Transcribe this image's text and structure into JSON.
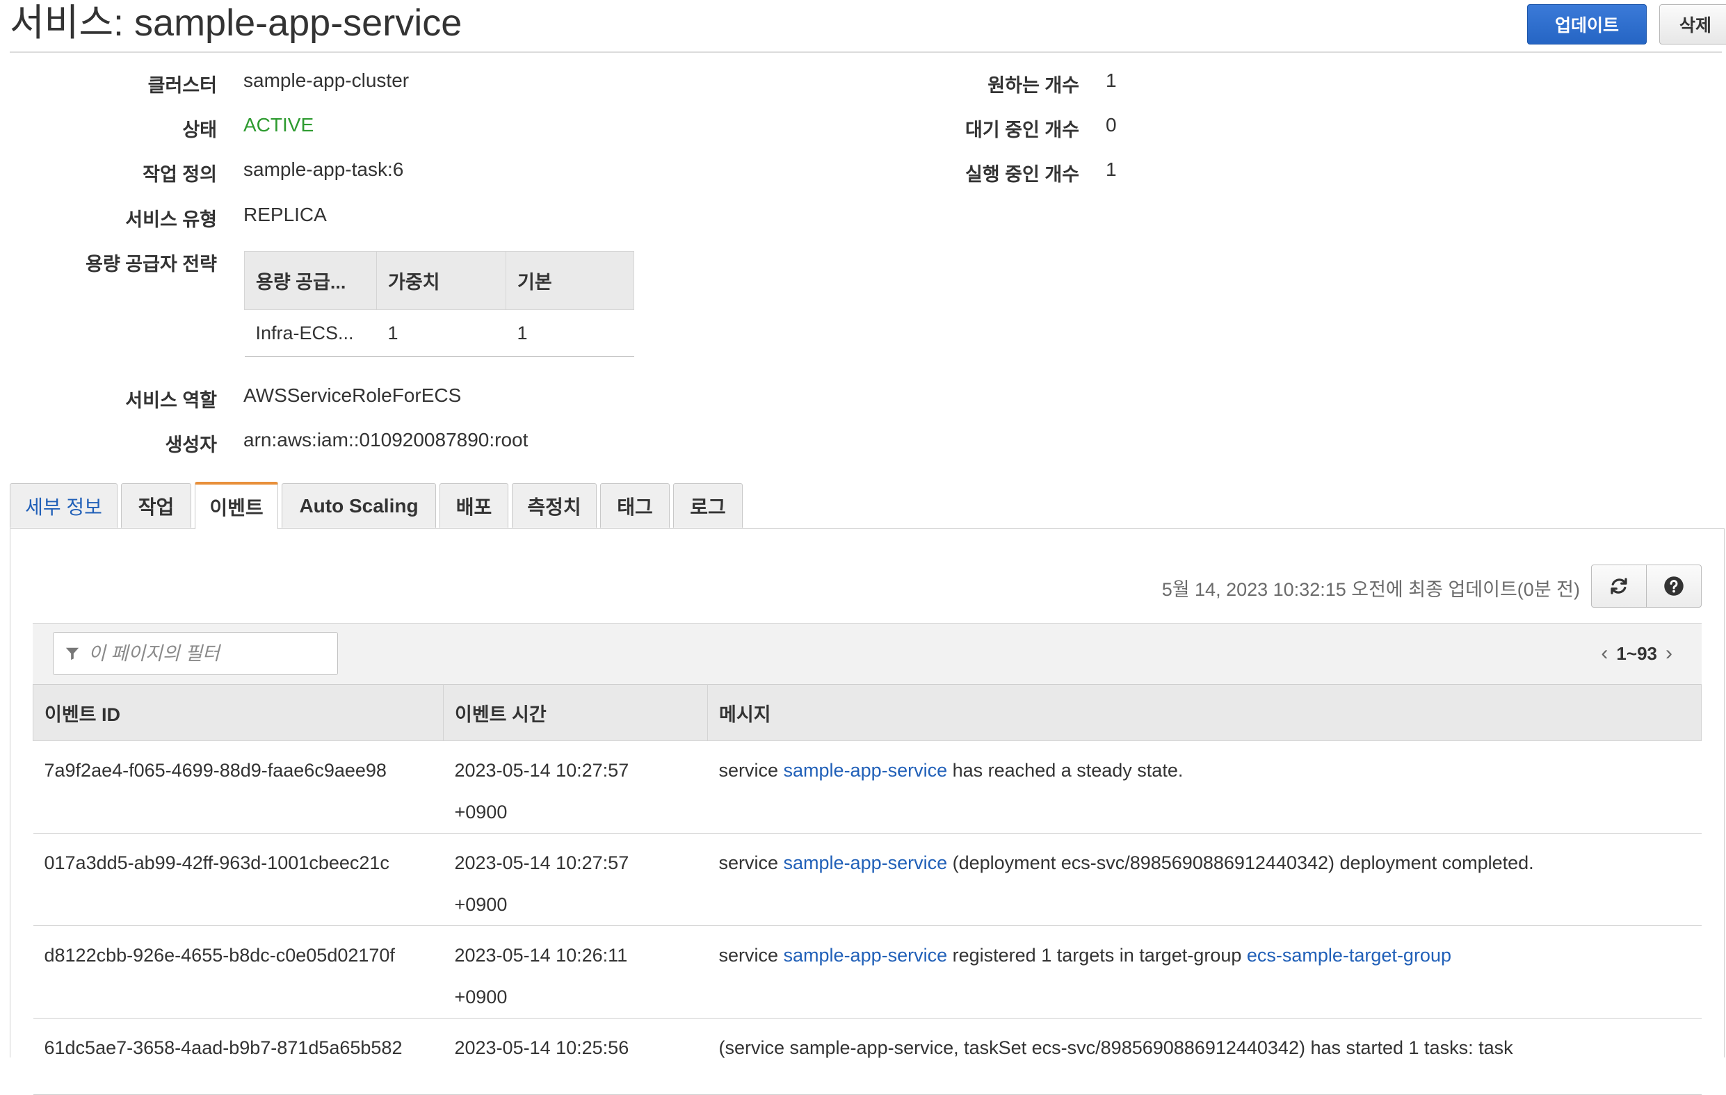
{
  "header": {
    "title": "서비스: sample-app-service",
    "update_button": "업데이트",
    "delete_button": "삭제"
  },
  "details": {
    "cluster_label": "클러스터",
    "cluster_value": "sample-app-cluster",
    "status_label": "상태",
    "status_value": "ACTIVE",
    "task_def_label": "작업 정의",
    "task_def_value": "sample-app-task:6",
    "service_type_label": "서비스 유형",
    "service_type_value": "REPLICA",
    "capacity_strategy_label": "용량 공급자 전략",
    "service_role_label": "서비스 역할",
    "service_role_value": "AWSServiceRoleForECS",
    "created_by_label": "생성자",
    "created_by_value": "arn:aws:iam::010920087890:root",
    "desired_label": "원하는 개수",
    "desired_value": "1",
    "pending_label": "대기 중인 개수",
    "pending_value": "0",
    "running_label": "실행 중인 개수",
    "running_value": "1"
  },
  "capacity_table": {
    "headers": [
      "용량 공급...",
      "가중치",
      "기본"
    ],
    "rows": [
      [
        "Infra-ECS...",
        "1",
        "1"
      ]
    ]
  },
  "tabs": [
    {
      "label": "세부 정보"
    },
    {
      "label": "작업"
    },
    {
      "label": "이벤트"
    },
    {
      "label": "Auto Scaling"
    },
    {
      "label": "배포"
    },
    {
      "label": "측정치"
    },
    {
      "label": "태그"
    },
    {
      "label": "로그"
    }
  ],
  "active_tab": "이벤트",
  "events_panel": {
    "last_updated": "5월 14, 2023 10:32:15 오전에 최종 업데이트(0분 전)",
    "refresh_icon": "refresh-icon",
    "help_icon": "question-circle-icon",
    "filter_placeholder": "이 페이지의 필터",
    "filter_icon": "funnel-icon",
    "pagination": "1~93"
  },
  "events_table": {
    "headers": [
      "이벤트 ID",
      "이벤트 시간",
      "메시지"
    ],
    "rows": [
      {
        "id": "7a9f2ae4-f065-4699-88d9-faae6c9aee98",
        "time_date": "2023-05-14 10:27:57",
        "time_tz": "+0900",
        "msg_pre": "service ",
        "msg_link": "sample-app-service",
        "msg_post": " has reached a steady state.",
        "msg_link2": "",
        "msg_tail": ""
      },
      {
        "id": "017a3dd5-ab99-42ff-963d-1001cbeec21c",
        "time_date": "2023-05-14 10:27:57",
        "time_tz": "+0900",
        "msg_pre": "service ",
        "msg_link": "sample-app-service",
        "msg_post": " (deployment ecs-svc/8985690886912440342) deployment completed.",
        "msg_link2": "",
        "msg_tail": ""
      },
      {
        "id": "d8122cbb-926e-4655-b8dc-c0e05d02170f",
        "time_date": "2023-05-14 10:26:11",
        "time_tz": "+0900",
        "msg_pre": "service ",
        "msg_link": "sample-app-service",
        "msg_post": " registered 1 targets in target-group ",
        "msg_link2": "ecs-sample-target-group",
        "msg_tail": ""
      },
      {
        "id": "61dc5ae7-3658-4aad-b9b7-871d5a65b582",
        "time_date": "2023-05-14 10:25:56",
        "time_tz": "",
        "msg_pre": "(service sample-app-service, taskSet ecs-svc/8985690886912440342) has started 1 tasks: task",
        "msg_link": "",
        "msg_post": "",
        "msg_link2": "",
        "msg_tail": ""
      }
    ]
  },
  "colors": {
    "link": "#2160b8",
    "active_status": "#2e9b30",
    "primary_button": "#2565c4",
    "active_tab_accent": "#e8903b"
  }
}
